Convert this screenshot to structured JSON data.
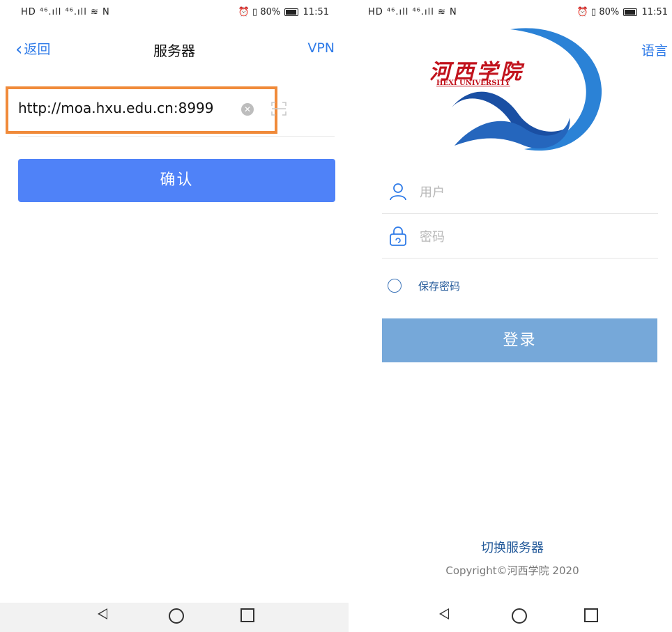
{
  "left": {
    "status": {
      "left": "HD ⁴⁶.ıll ⁴⁶.ıll ≋ N",
      "battery": "80%",
      "time": "11:51"
    },
    "nav": {
      "back_label": "返回",
      "title": "服务器",
      "vpn_label": "VPN"
    },
    "server": {
      "value": "http://moa.hxu.edu.cn:8999"
    },
    "confirm_label": "确认"
  },
  "right": {
    "status": {
      "left": "HD ⁴⁶.ıll ⁴⁶.ıll ≋ N",
      "battery": "80%",
      "time": "11:51"
    },
    "language_label": "语言",
    "logo": {
      "cn": "河西学院",
      "en": "HEXI UNIVERSITY"
    },
    "user_placeholder": "用户",
    "password_placeholder": "密码",
    "save_password_label": "保存密码",
    "login_label": "登录",
    "switch_server_label": "切换服务器",
    "copyright": "Copyright©河西学院 2020",
    "colors": {
      "ribbon": "#2b82d6",
      "ribbon_dark": "#1a4fa3",
      "logo_red": "#c1121c"
    }
  }
}
